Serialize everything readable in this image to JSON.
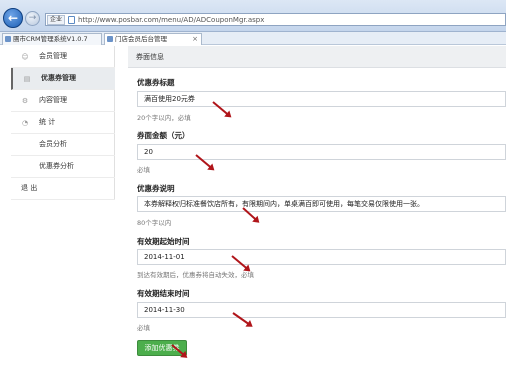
{
  "browser": {
    "security_label": "企业",
    "url": "http://www.posbar.com/menu/AD/ADCouponMgr.aspx",
    "tabs": [
      {
        "label": "團市CRM管理系统V1.0.7"
      },
      {
        "label": "门店会员后台管理"
      }
    ]
  },
  "sidebar": {
    "items": [
      {
        "label": "会员管理",
        "icon": "user-icon"
      },
      {
        "label": "优惠券管理",
        "icon": "coupon-icon"
      },
      {
        "label": "内容管理",
        "icon": "gear-icon"
      },
      {
        "label": "统 计",
        "icon": "chart-icon"
      },
      {
        "label": "会员分析"
      },
      {
        "label": "优惠券分析"
      },
      {
        "label": "退 出"
      }
    ]
  },
  "form": {
    "section_title": "券面信息",
    "title_label": "优惠券标题",
    "title_value": "满百使用20元券",
    "title_hint": "20个字以内，必填",
    "amount_label": "券面金额（元）",
    "amount_value": "20",
    "amount_hint": "必填",
    "desc_label": "优惠券说明",
    "desc_value": "本券解释权归标准餐饮店所有，有限期间内，单桌满百即可使用，每笔交易仅限使用一张。",
    "desc_hint": "80个字以内",
    "start_label": "有效期起始时间",
    "start_value": "2014-11-01",
    "start_hint": "到达有效期后，优惠券将自动失效，必填",
    "end_label": "有效期结束时间",
    "end_value": "2014-11-30",
    "end_hint": "必填",
    "submit_label": "添加优惠券"
  },
  "colors": {
    "accent": "#4cae4c",
    "annotation": "#b0151a"
  }
}
